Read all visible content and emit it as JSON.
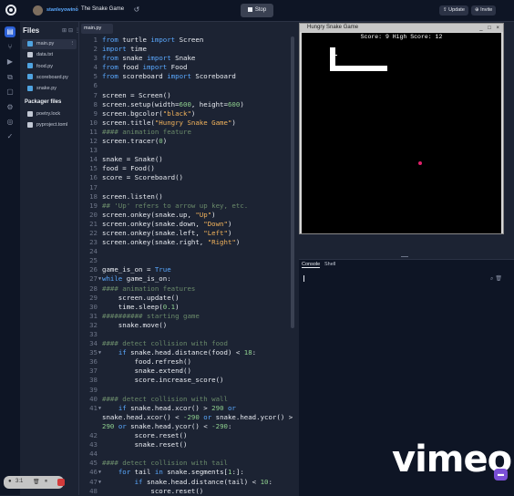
{
  "topbar": {
    "username": "stanleyowino",
    "separator": "/",
    "project_name": "The Snake Game",
    "stop_label": "Stop",
    "update_label": "Update",
    "invite_label": "Invite"
  },
  "files_panel": {
    "title": "Files",
    "files": [
      {
        "name": "main.py",
        "color": "#4fa3e0",
        "active": true
      },
      {
        "name": "data.txt",
        "color": "#c2c8d4",
        "active": false
      },
      {
        "name": "food.py",
        "color": "#4fa3e0",
        "active": false
      },
      {
        "name": "scoreboard.py",
        "color": "#4fa3e0",
        "active": false
      },
      {
        "name": "snake.py",
        "color": "#4fa3e0",
        "active": false
      }
    ],
    "packager_title": "Packager files",
    "packager_files": [
      {
        "name": "poetry.lock",
        "color": "#c2c8d4"
      },
      {
        "name": "pyproject.toml",
        "color": "#c2c8d4"
      }
    ]
  },
  "editor": {
    "tab_label": "main.py",
    "lines": [
      {
        "n": "1",
        "arrow": "",
        "html": "<span class='kw'>from</span> turtle <span class='kw'>import</span> Screen"
      },
      {
        "n": "2",
        "arrow": "",
        "html": "<span class='kw'>import</span> time"
      },
      {
        "n": "3",
        "arrow": "",
        "html": "<span class='kw'>from</span> snake <span class='kw'>import</span> Snake"
      },
      {
        "n": "4",
        "arrow": "",
        "html": "<span class='kw'>from</span> food <span class='kw'>import</span> Food"
      },
      {
        "n": "5",
        "arrow": "",
        "html": "<span class='kw'>from</span> scoreboard <span class='kw'>import</span> Scoreboard"
      },
      {
        "n": "6",
        "arrow": "",
        "html": ""
      },
      {
        "n": "7",
        "arrow": "",
        "html": "screen = Screen()"
      },
      {
        "n": "8",
        "arrow": "",
        "html": "screen.setup(width=<span class='num'>600</span>, height=<span class='num'>600</span>)"
      },
      {
        "n": "9",
        "arrow": "",
        "html": "screen.bgcolor(<span class='str'>\"black\"</span>)"
      },
      {
        "n": "10",
        "arrow": "",
        "html": "screen.title(<span class='str'>\"Hungry Snake Game\"</span>)"
      },
      {
        "n": "11",
        "arrow": "",
        "html": "<span class='cm'>#### animation feature</span>"
      },
      {
        "n": "12",
        "arrow": "",
        "html": "screen.tracer(<span class='num'>0</span>)"
      },
      {
        "n": "13",
        "arrow": "",
        "html": ""
      },
      {
        "n": "14",
        "arrow": "",
        "html": "snake = Snake()"
      },
      {
        "n": "15",
        "arrow": "",
        "html": "food = Food()"
      },
      {
        "n": "16",
        "arrow": "",
        "html": "score = Scoreboard()"
      },
      {
        "n": "17",
        "arrow": "",
        "html": ""
      },
      {
        "n": "18",
        "arrow": "",
        "html": "screen.listen()"
      },
      {
        "n": "19",
        "arrow": "",
        "html": "<span class='cm'>## 'Up' refers to arrow up key, etc.</span>"
      },
      {
        "n": "20",
        "arrow": "",
        "html": "screen.onkey(snake.up, <span class='str'>\"Up\"</span>)"
      },
      {
        "n": "21",
        "arrow": "",
        "html": "screen.onkey(snake.down, <span class='str'>\"Down\"</span>)"
      },
      {
        "n": "22",
        "arrow": "",
        "html": "screen.onkey(snake.left, <span class='str'>\"Left\"</span>)"
      },
      {
        "n": "23",
        "arrow": "",
        "html": "screen.onkey(snake.right, <span class='str'>\"Right\"</span>)"
      },
      {
        "n": "24",
        "arrow": "",
        "html": ""
      },
      {
        "n": "25",
        "arrow": "",
        "html": ""
      },
      {
        "n": "26",
        "arrow": "",
        "html": "game_is_on = <span class='kw'>True</span>"
      },
      {
        "n": "27",
        "arrow": "▼",
        "html": "<span class='kw'>while</span> game_is_on:"
      },
      {
        "n": "28",
        "arrow": "",
        "html": "<span class='cm'>#### animation features</span>"
      },
      {
        "n": "29",
        "arrow": "",
        "html": "    screen.update()"
      },
      {
        "n": "30",
        "arrow": "",
        "html": "    time.sleep(<span class='num'>0.1</span>)"
      },
      {
        "n": "31",
        "arrow": "",
        "html": "<span class='cm'>########## starting game</span>"
      },
      {
        "n": "32",
        "arrow": "",
        "html": "    snake.move()"
      },
      {
        "n": "33",
        "arrow": "",
        "html": ""
      },
      {
        "n": "34",
        "arrow": "",
        "html": "<span class='cm'>#### detect collision with food</span>"
      },
      {
        "n": "35",
        "arrow": "▼",
        "html": "    <span class='kw'>if</span> snake.head.distance(food) &lt; <span class='num'>18</span>:"
      },
      {
        "n": "36",
        "arrow": "",
        "html": "        food.refresh()"
      },
      {
        "n": "37",
        "arrow": "",
        "html": "        snake.extend()"
      },
      {
        "n": "38",
        "arrow": "",
        "html": "        score.increase_score()"
      },
      {
        "n": "39",
        "arrow": "",
        "html": ""
      },
      {
        "n": "40",
        "arrow": "",
        "html": "<span class='cm'>#### detect collision with wall</span>"
      },
      {
        "n": "41",
        "arrow": "▼",
        "html": "    <span class='kw'>if</span> snake.head.xcor() &gt; <span class='num'>290</span> <span class='kw'>or</span>"
      },
      {
        "n": "",
        "arrow": "",
        "html": "snake.head.xcor() &lt; <span class='num'>-290</span> <span class='kw'>or</span> snake.head.ycor() &gt;"
      },
      {
        "n": "",
        "arrow": "",
        "html": "<span class='num'>290</span> <span class='kw'>or</span> snake.head.ycor() &lt; <span class='num'>-290</span>:"
      },
      {
        "n": "42",
        "arrow": "",
        "html": "        score.reset()"
      },
      {
        "n": "43",
        "arrow": "",
        "html": "        snake.reset()"
      },
      {
        "n": "44",
        "arrow": "",
        "html": ""
      },
      {
        "n": "45",
        "arrow": "",
        "html": "<span class='cm'>#### detect collision with tail</span>"
      },
      {
        "n": "46",
        "arrow": "▼",
        "html": "    <span class='kw'>for</span> tail <span class='kw'>in</span> snake.segments[<span class='num'>1</span>:]:"
      },
      {
        "n": "47",
        "arrow": "▼",
        "html": "        <span class='kw'>if</span> snake.head.distance(tail) &lt; <span class='num'>10</span>:"
      },
      {
        "n": "48",
        "arrow": "",
        "html": "            score.reset()"
      }
    ]
  },
  "game_window": {
    "title": "Hungry Snake Game",
    "score_text": "Score: 9 High Score: 12",
    "controls": "_ □ ×"
  },
  "console": {
    "tab_console": "Console",
    "tab_shell": "Shell"
  },
  "overlay": {
    "watermark": "vimeo",
    "record_timer": "3:1"
  },
  "colors": {
    "accent": "#2a5fd6",
    "background": "#1c2333",
    "topbar": "#0e1525"
  }
}
